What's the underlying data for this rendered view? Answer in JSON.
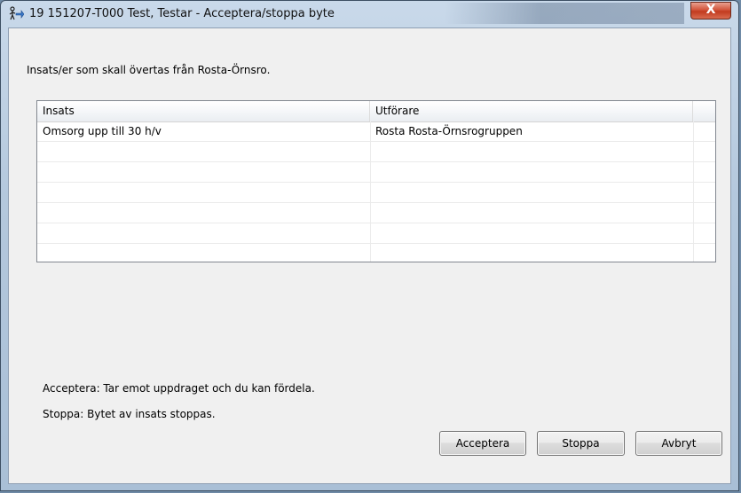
{
  "window": {
    "title": "19 151207-T000 Test, Testar - Acceptera/stoppa byte",
    "close_glyph": "X"
  },
  "heading": "Insats/er som skall övertas från Rosta-Örnsro.",
  "table": {
    "columns": [
      "Insats",
      "Utförare"
    ],
    "rows": [
      [
        "Omsorg upp till 30 h/v",
        "Rosta Rosta-Örnsrogruppen"
      ]
    ]
  },
  "info": {
    "accept_text": "Acceptera: Tar emot uppdraget och du kan fördela.",
    "stop_text": "Stoppa: Bytet av insats stoppas."
  },
  "buttons": {
    "accept": "Acceptera",
    "stop": "Stoppa",
    "cancel": "Avbryt"
  },
  "icons": {
    "app": "person-transfer-icon",
    "close": "close-icon"
  }
}
